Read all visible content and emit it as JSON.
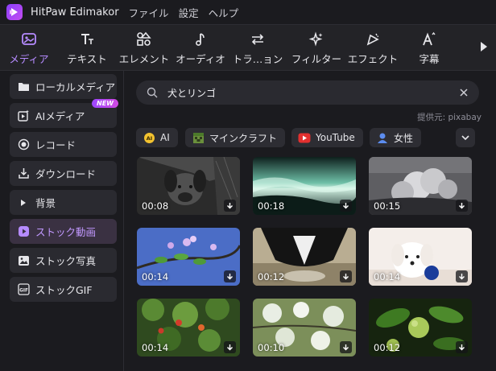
{
  "app": {
    "title": "HitPaw Edimakor"
  },
  "menu": [
    "ファイル",
    "設定",
    "ヘルプ"
  ],
  "toolbar": {
    "tools": [
      {
        "label": "メディア",
        "icon": "media-icon",
        "active": true
      },
      {
        "label": "テキスト",
        "icon": "text-icon"
      },
      {
        "label": "エレメント",
        "icon": "element-icon"
      },
      {
        "label": "オーディオ",
        "icon": "audio-icon"
      },
      {
        "label": "トラ…ョン",
        "icon": "transition-icon"
      },
      {
        "label": "フィルター",
        "icon": "filter-icon"
      },
      {
        "label": "エフェクト",
        "icon": "effect-icon"
      },
      {
        "label": "字幕",
        "icon": "subtitle-icon"
      }
    ]
  },
  "sidebar": {
    "items": [
      {
        "label": "ローカルメディア",
        "icon": "folder-icon"
      },
      {
        "label": "AIメディア",
        "icon": "ai-media-icon",
        "badge": "NEW"
      },
      {
        "label": "レコード",
        "icon": "record-icon"
      },
      {
        "label": "ダウンロード",
        "icon": "download-icon"
      },
      {
        "label": "背景",
        "icon": "triangle-right-icon"
      },
      {
        "label": "ストック動画",
        "icon": "stock-video-icon",
        "active": true
      },
      {
        "label": "ストック写真",
        "icon": "stock-photo-icon"
      },
      {
        "label": "ストックGIF",
        "icon": "gif-icon"
      }
    ]
  },
  "search": {
    "value": "犬とリンゴ",
    "placeholder": ""
  },
  "provider": "提供元: pixabay",
  "chips": [
    {
      "label": "AI",
      "icon": "ai-chip-icon"
    },
    {
      "label": "マインクラフト",
      "icon": "minecraft-icon"
    },
    {
      "label": "YouTube",
      "icon": "youtube-icon"
    },
    {
      "label": "女性",
      "icon": "woman-icon"
    }
  ],
  "videos": [
    {
      "duration": "00:08"
    },
    {
      "duration": "00:18"
    },
    {
      "duration": "00:15"
    },
    {
      "duration": "00:14"
    },
    {
      "duration": "00:12"
    },
    {
      "duration": "00:14"
    },
    {
      "duration": "00:14"
    },
    {
      "duration": "00:10"
    },
    {
      "duration": "00:12"
    }
  ],
  "colors": {
    "accent": "#b68bff",
    "background": "#1b1b1f",
    "panel": "#2a2a30"
  }
}
